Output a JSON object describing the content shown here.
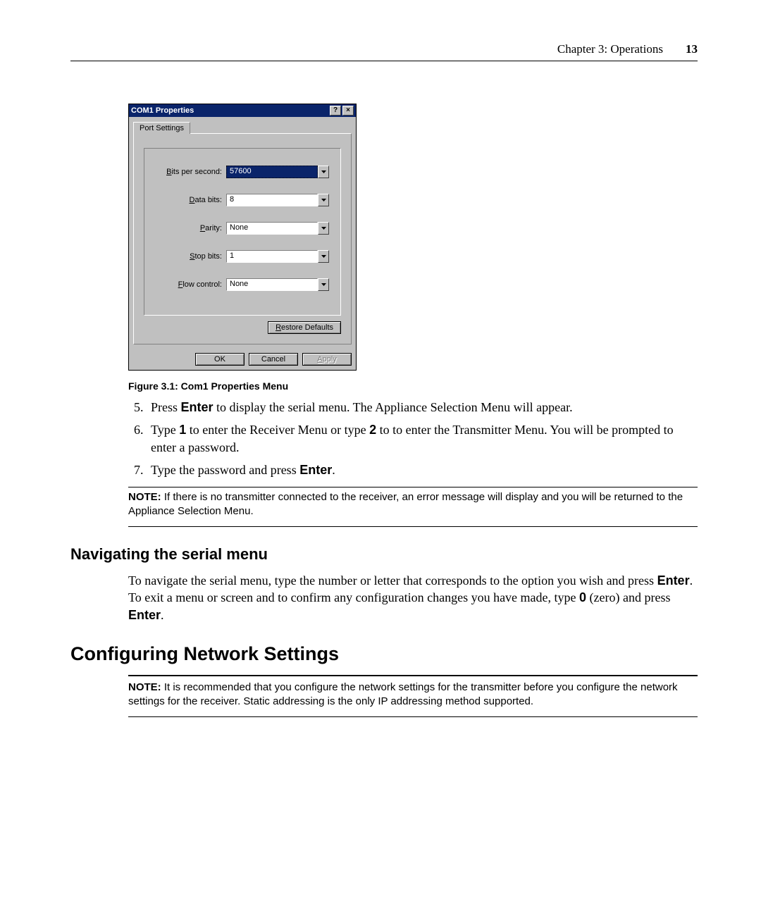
{
  "header": {
    "chapter": "Chapter 3: Operations",
    "page_number": "13"
  },
  "dialog": {
    "title": "COM1 Properties",
    "help_btn": "?",
    "close_btn": "×",
    "tab": "Port Settings",
    "fields": {
      "bps_label_pre": "B",
      "bps_label_post": "its per second:",
      "bps_value": "57600",
      "databits_label_pre": "D",
      "databits_label_post": "ata bits:",
      "databits_value": "8",
      "parity_label_pre": "P",
      "parity_label_post": "arity:",
      "parity_value": "None",
      "stopbits_label_pre": "S",
      "stopbits_label_post": "top bits:",
      "stopbits_value": "1",
      "flow_label_pre": "F",
      "flow_label_post": "low control:",
      "flow_value": "None"
    },
    "restore_pre": "R",
    "restore_post": "estore Defaults",
    "ok": "OK",
    "cancel": "Cancel",
    "apply_pre": "A",
    "apply_post": "pply"
  },
  "figure_caption": "Figure 3.1: Com1 Properties Menu",
  "steps": {
    "s5a": "Press ",
    "s5b": "Enter",
    "s5c": " to display the serial menu. The Appliance Selection Menu will appear.",
    "s6a": "Type ",
    "s6b": "1",
    "s6c": " to enter the Receiver Menu or type ",
    "s6d": "2",
    "s6e": " to to enter the Transmitter Menu. You will be prompted to enter a password.",
    "s7a": "Type the password and press ",
    "s7b": "Enter",
    "s7c": "."
  },
  "note1_label": "NOTE:",
  "note1_text": " If there is no transmitter connected to the receiver, an error message will display and you will be returned to the Appliance Selection Menu.",
  "h2": "Navigating the serial menu",
  "nav_a": "To navigate the serial menu, type the number or letter that corresponds to the option you wish and press ",
  "nav_b": "Enter",
  "nav_c": ". To exit a menu or screen and to confirm any configuration changes you have made, type ",
  "nav_d": "0",
  "nav_e": " (zero) and press ",
  "nav_f": "Enter",
  "nav_g": ".",
  "h1": "Configuring Network Settings",
  "note2_label": "NOTE:",
  "note2_text": " It is recommended that you configure the network settings for the transmitter before you configure the network settings for the receiver. Static addressing is the only IP addressing method supported."
}
